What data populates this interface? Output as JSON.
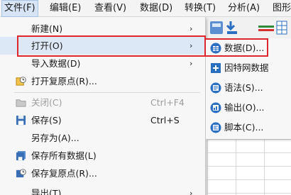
{
  "menubar": [
    {
      "label": "文件(F)",
      "active": true
    },
    {
      "label": "编辑(E)"
    },
    {
      "label": "查看(V)"
    },
    {
      "label": "数据(D)"
    },
    {
      "label": "转换(T)"
    },
    {
      "label": "分析(A)"
    },
    {
      "label": "图形"
    }
  ],
  "file_menu": {
    "new": "新建(N)",
    "open": "打开(O)",
    "import": "导入数据(D)",
    "open_restore": "打开复原点(R)...",
    "close": "关闭(C)",
    "close_shortcut": "Ctrl+F4",
    "save": "保存(S)",
    "save_shortcut": "Ctrl+S",
    "save_as": "另存为(A)...",
    "save_all": "保存所有数据(L)",
    "save_restore": "保存复原点(R)...",
    "export": "导出(T)"
  },
  "open_submenu": {
    "data": "数据(D)...",
    "internet_data": "因特网数据",
    "syntax": "语法(S)...",
    "output": "输出(O)...",
    "script": "脚本(C)..."
  },
  "colors": {
    "highlight": "#e0262b",
    "icon_blue": "#2b6fc2"
  }
}
